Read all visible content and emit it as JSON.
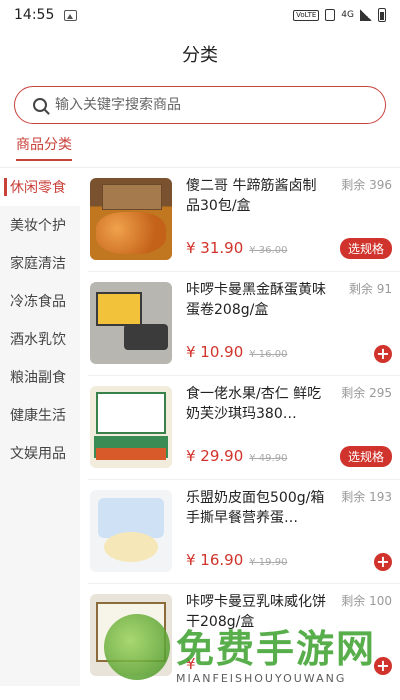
{
  "status": {
    "time": "14:55",
    "volte": "VoLTE",
    "network": "4G"
  },
  "header": {
    "title": "分类"
  },
  "search": {
    "placeholder": "输入关键字搜索商品"
  },
  "category_tab": {
    "label": "商品分类"
  },
  "sidebar": {
    "items": [
      {
        "label": "休闲零食",
        "active": true
      },
      {
        "label": "美妆个护"
      },
      {
        "label": "家庭清洁"
      },
      {
        "label": "冷冻食品"
      },
      {
        "label": "酒水乳饮"
      },
      {
        "label": "粮油副食"
      },
      {
        "label": "健康生活"
      },
      {
        "label": "文娱用品"
      }
    ]
  },
  "products": [
    {
      "name": "傻二哥 牛蹄筋酱卤制品30包/盒",
      "stock": "剩余 396",
      "price": "¥ 31.90",
      "old_price": "¥ 36.00",
      "action": "选规格"
    },
    {
      "name": "咔啰卡曼黑金酥蛋黄味蛋卷208g/盒",
      "stock": "剩余 91",
      "price": "¥ 10.90",
      "old_price": "¥ 16.00",
      "action": "+"
    },
    {
      "name": "食一佬水果/杏仁 鲜吃奶芙沙琪玛380…",
      "stock": "剩余 295",
      "price": "¥ 29.90",
      "old_price": "¥ 49.90",
      "action": "选规格"
    },
    {
      "name": "乐盟奶皮面包500g/箱 手撕早餐营养蛋…",
      "stock": "剩余 193",
      "price": "¥ 16.90",
      "old_price": "¥ 19.90",
      "action": "+"
    },
    {
      "name": "咔啰卡曼豆乳味威化饼干208g/盒",
      "stock": "剩余 100",
      "price": "¥",
      "old_price": "",
      "action": "+"
    }
  ],
  "watermark": {
    "text": "免费手游网",
    "sub": "MIANFEISHOUYOUWANG"
  },
  "colors": {
    "accent": "#d0332b",
    "border": "#c9423a"
  }
}
